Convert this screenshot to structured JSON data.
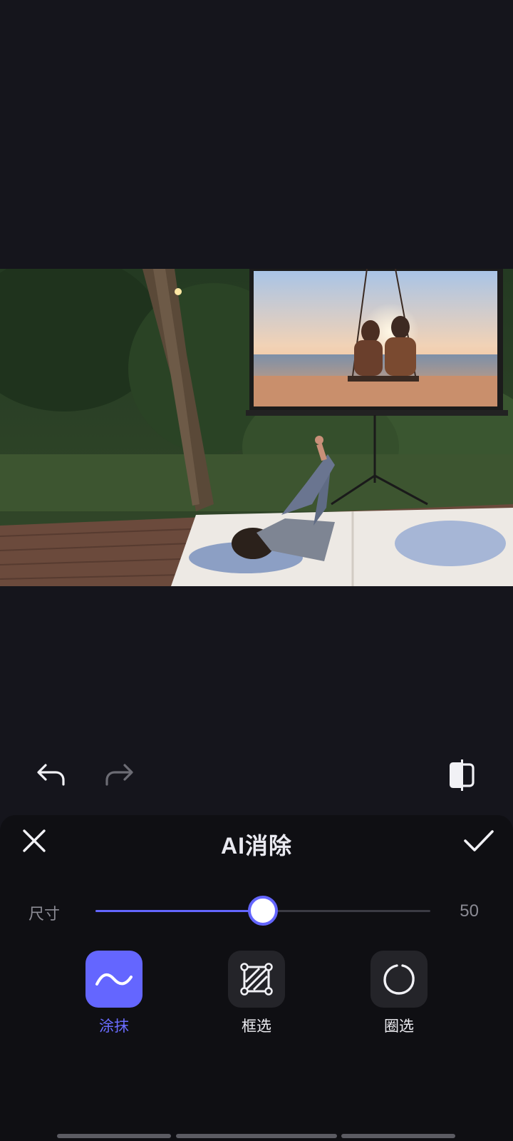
{
  "editor": {
    "title": "AI消除",
    "close_icon": "close-icon",
    "confirm_icon": "checkmark-icon"
  },
  "history": {
    "undo_icon": "undo-icon",
    "redo_icon": "redo-icon",
    "compare_icon": "compare-icon",
    "redo_enabled": false
  },
  "size": {
    "label": "尺寸",
    "value": "50",
    "level_percent": 50
  },
  "tools": [
    {
      "label": "涂抹",
      "icon": "brush-wave-icon",
      "active": true
    },
    {
      "label": "框选",
      "icon": "box-select-icon",
      "active": false
    },
    {
      "label": "圈选",
      "icon": "lasso-circle-icon",
      "active": false
    }
  ],
  "colors": {
    "accent": "#6466ff",
    "background": "#15151c",
    "panel": "#0f0f13",
    "tool_inactive": "#242429"
  }
}
